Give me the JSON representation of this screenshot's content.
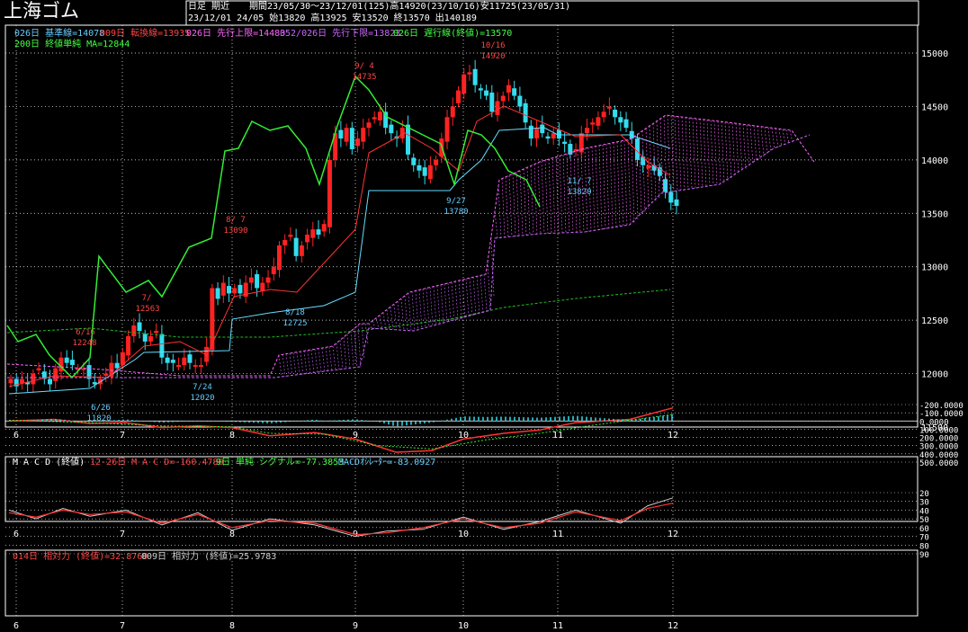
{
  "header": {
    "title": "上海ゴム",
    "period_label": "日足 期近",
    "stats_line1": "期間23/05/30～23/12/01(125)高14920(23/10/16)安11725(23/05/31)",
    "stats_line2": "23/12/01 24/05 始13820 高13925 安13520 終13570 出140189"
  },
  "legend_main": [
    {
      "text": "026日 基準線=14078",
      "color": "#66ccff"
    },
    {
      "text": "009日 転換線=13935",
      "color": "#ff4444"
    },
    {
      "text": "026日 先行上限=14483",
      "color": "#ff66ff"
    },
    {
      "text": "052/026日 先行下限=13823",
      "color": "#cc66ff"
    },
    {
      "text": "026日 遅行線(終値)=13570",
      "color": "#44ff44"
    },
    {
      "text": "200日 終値単純 MA=12844",
      "color": "#44ff44"
    }
  ],
  "legend_macd": [
    {
      "text": "M A C D (終値)",
      "color": "#ffffff"
    },
    {
      "text": "12-26日 M A C D=-160.4780",
      "color": "#ff4444"
    },
    {
      "text": "9日 単純 シグナル=-77.3853",
      "color": "#44ff44"
    },
    {
      "text": "MACDｵｼﾚｰﾀｰ=-83.0927",
      "color": "#66ccff"
    }
  ],
  "legend_rsi": [
    {
      "text": "014日 相対力 (終値)=32.8760",
      "color": "#ff4444"
    },
    {
      "text": "009日 相対力 (終値)=25.9783",
      "color": "#cccccc"
    }
  ],
  "annotations": [
    {
      "text": "6/26",
      "color": "#66ccff"
    },
    {
      "text": "11820",
      "color": "#66ccff"
    },
    {
      "text": "6/16",
      "color": "#ff4444"
    },
    {
      "text": "12248",
      "color": "#ff4444"
    },
    {
      "text": "7/",
      "color": "#ff4444"
    },
    {
      "text": "12563",
      "color": "#ff4444"
    },
    {
      "text": "7/24",
      "color": "#66ccff"
    },
    {
      "text": "12020",
      "color": "#66ccff"
    },
    {
      "text": "8/ 7",
      "color": "#ff4444"
    },
    {
      "text": "13090",
      "color": "#ff4444"
    },
    {
      "text": "8/18",
      "color": "#66ccff"
    },
    {
      "text": "12725",
      "color": "#66ccff"
    },
    {
      "text": "9/ 4",
      "color": "#ff4444"
    },
    {
      "text": "14735",
      "color": "#ff4444"
    },
    {
      "text": "9/27",
      "color": "#66ccff"
    },
    {
      "text": "13780",
      "color": "#66ccff"
    },
    {
      "text": "10/16",
      "color": "#ff4444"
    },
    {
      "text": "14920",
      "color": "#ff4444"
    },
    {
      "text": "11/ 7",
      "color": "#66ccff"
    },
    {
      "text": "13820",
      "color": "#66ccff"
    }
  ],
  "x_labels": [
    "6",
    "7",
    "8",
    "9",
    "10",
    "11",
    "12"
  ],
  "y_main": [
    "15000",
    "14500",
    "14000",
    "13500",
    "13000",
    "12500",
    "12000",
    "11500"
  ],
  "y_macd": [
    "500.0000",
    "400.0000",
    "300.0000",
    "200.0000",
    "100.0000",
    "0.0000",
    "-100.0000",
    "-200.0000"
  ],
  "y_rsi": [
    "90",
    "80",
    "70",
    "60",
    "50",
    "40",
    "30",
    "20"
  ],
  "colors": {
    "up": "#ff2222",
    "down": "#33ddee",
    "kijun": "#66ddff",
    "tenkan": "#ff3333",
    "chikou": "#33ee33",
    "ma": "#22bb22",
    "span1": "#ff66ff",
    "span2": "#cc66ff",
    "grid": "#ffffff"
  },
  "chart_data": {
    "type": "candlestick",
    "price_axis": [
      11500,
      15000
    ],
    "ohlc_closes": [
      11950,
      11880,
      11950,
      11900,
      12000,
      12050,
      11950,
      11900,
      12050,
      12150,
      12100,
      12080,
      12050,
      12050,
      11950,
      11900,
      11950,
      12000,
      12100,
      12050,
      12200,
      12350,
      12450,
      12400,
      12300,
      12350,
      12400,
      12150,
      12100,
      12100,
      12080,
      12150,
      12100,
      12080,
      12080,
      12250,
      12800,
      12700,
      12850,
      12750,
      12800,
      12750,
      12850,
      12900,
      12800,
      12850,
      12900,
      13000,
      13200,
      13250,
      13300,
      13100,
      13200,
      13300,
      13350,
      13300,
      13400,
      14000,
      14250,
      14200,
      14300,
      14100,
      14200,
      14300,
      14350,
      14400,
      14450,
      14300,
      14250,
      14200,
      14300,
      14050,
      13950,
      13900,
      13850,
      13950,
      14000,
      14200,
      14400,
      14500,
      14650,
      14800,
      14820,
      14700,
      14650,
      14600,
      14450,
      14550,
      14600,
      14700,
      14600,
      14500,
      14350,
      14200,
      14300,
      14250,
      14200,
      14250,
      14200,
      14150,
      14050,
      14100,
      14250,
      14300,
      14350,
      14400,
      14450,
      14500,
      14400,
      14350,
      14300,
      14200,
      14000,
      13950,
      13950,
      13900,
      13850,
      13700,
      13600,
      13570
    ],
    "macd_range": [
      -200,
      500
    ],
    "rsi_range": [
      20,
      90
    ]
  }
}
